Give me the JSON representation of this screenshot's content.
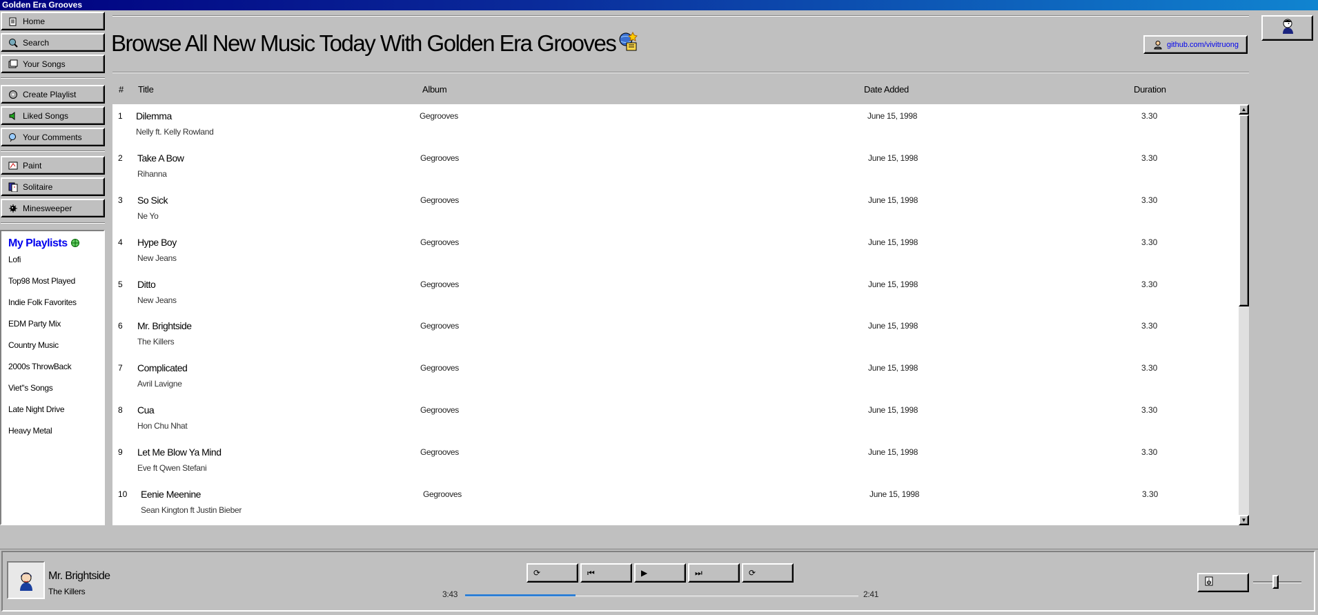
{
  "window": {
    "title": "Golden Era Grooves"
  },
  "sidebar": {
    "nav_top": [
      {
        "label": "Home",
        "icon": "home-icon"
      },
      {
        "label": "Search",
        "icon": "search-icon"
      },
      {
        "label": "Your Songs",
        "icon": "songs-icon"
      }
    ],
    "nav_mid": [
      {
        "label": "Create Playlist",
        "icon": "create-playlist-icon"
      },
      {
        "label": "Liked Songs",
        "icon": "speaker-icon"
      },
      {
        "label": "Your Comments",
        "icon": "comments-icon"
      }
    ],
    "nav_apps": [
      {
        "label": "Paint",
        "icon": "paint-icon"
      },
      {
        "label": "Solitaire",
        "icon": "solitaire-icon"
      },
      {
        "label": "Minesweeper",
        "icon": "minesweeper-icon"
      }
    ],
    "playlists_title": "My Playlists",
    "playlists": [
      "Lofi",
      "Top98 Most Played",
      "Indie Folk Favorites",
      "EDM Party Mix",
      "Country Music",
      "2000s ThrowBack",
      "Viet''s Songs",
      "Late Night Drive",
      "Heavy Metal"
    ]
  },
  "header": {
    "headline": "Browse All New Music Today With Golden Era Grooves",
    "github_link": "github.com/vivitruong"
  },
  "table": {
    "columns": [
      "#",
      "Title",
      "Album",
      "Date Added",
      "Duration"
    ],
    "rows": [
      {
        "num": "1",
        "title": "Dilemma",
        "artist": "Nelly ft. Kelly Rowland",
        "album": "Gegrooves",
        "date": "June 15, 1998",
        "duration": "3.30"
      },
      {
        "num": "2",
        "title": "Take A Bow",
        "artist": "Rihanna",
        "album": "Gegrooves",
        "date": "June 15, 1998",
        "duration": "3.30"
      },
      {
        "num": "3",
        "title": "So Sick",
        "artist": "Ne Yo",
        "album": "Gegrooves",
        "date": "June 15, 1998",
        "duration": "3.30"
      },
      {
        "num": "4",
        "title": "Hype Boy",
        "artist": "New Jeans",
        "album": "Gegrooves",
        "date": "June 15, 1998",
        "duration": "3.30"
      },
      {
        "num": "5",
        "title": "Ditto",
        "artist": "New Jeans",
        "album": "Gegrooves",
        "date": "June 15, 1998",
        "duration": "3.30"
      },
      {
        "num": "6",
        "title": "Mr. Brightside",
        "artist": "The Killers",
        "album": "Gegrooves",
        "date": "June 15, 1998",
        "duration": "3.30"
      },
      {
        "num": "7",
        "title": "Complicated",
        "artist": "Avril Lavigne",
        "album": "Gegrooves",
        "date": "June 15, 1998",
        "duration": "3.30"
      },
      {
        "num": "8",
        "title": "Cua",
        "artist": "Hon Chu Nhat",
        "album": "Gegrooves",
        "date": "June 15, 1998",
        "duration": "3.30"
      },
      {
        "num": "9",
        "title": "Let Me Blow Ya Mind",
        "artist": "Eve ft Qwen Stefani",
        "album": "Gegrooves",
        "date": "June 15, 1998",
        "duration": "3.30"
      },
      {
        "num": "10",
        "title": "Eenie Meenine",
        "artist": "Sean Kington ft Justin Bieber",
        "album": "Gegrooves",
        "date": "June 15, 1998",
        "duration": "3.30"
      }
    ]
  },
  "player": {
    "now_playing": {
      "title": "Mr. Brightside",
      "artist": "The Killers"
    },
    "controls": [
      {
        "name": "shuffle-button",
        "icon": "shuffle-icon"
      },
      {
        "name": "previous-button",
        "icon": "previous-icon"
      },
      {
        "name": "play-button",
        "icon": "play-icon"
      },
      {
        "name": "next-button",
        "icon": "next-icon"
      },
      {
        "name": "repeat-button",
        "icon": "repeat-icon"
      }
    ],
    "time_elapsed": "3:43",
    "time_total": "2:41",
    "progress": 0.28,
    "volume": 0.45,
    "accent_color": "#2d7fd6"
  }
}
